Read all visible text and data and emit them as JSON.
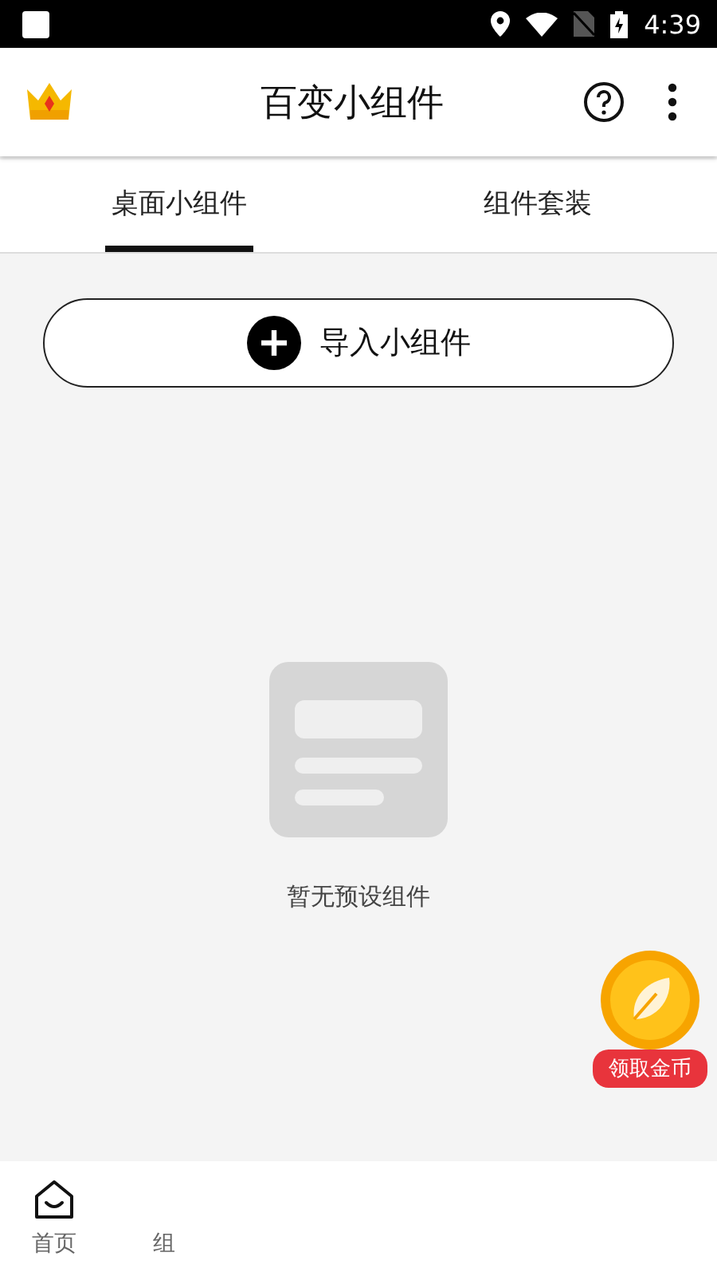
{
  "status_bar": {
    "time": "4:39"
  },
  "app_bar": {
    "title": "百变小组件"
  },
  "tabs": [
    {
      "label": "桌面小组件",
      "selected": true
    },
    {
      "label": "组件套装",
      "selected": false
    }
  ],
  "import_button": {
    "label": "导入小组件"
  },
  "empty_state": {
    "message": "暂无预设组件"
  },
  "coin_badge": {
    "label": "领取金币"
  },
  "bottom_nav": [
    {
      "label": "首页",
      "kind": "home"
    },
    {
      "label": "组",
      "kind": "text"
    }
  ]
}
